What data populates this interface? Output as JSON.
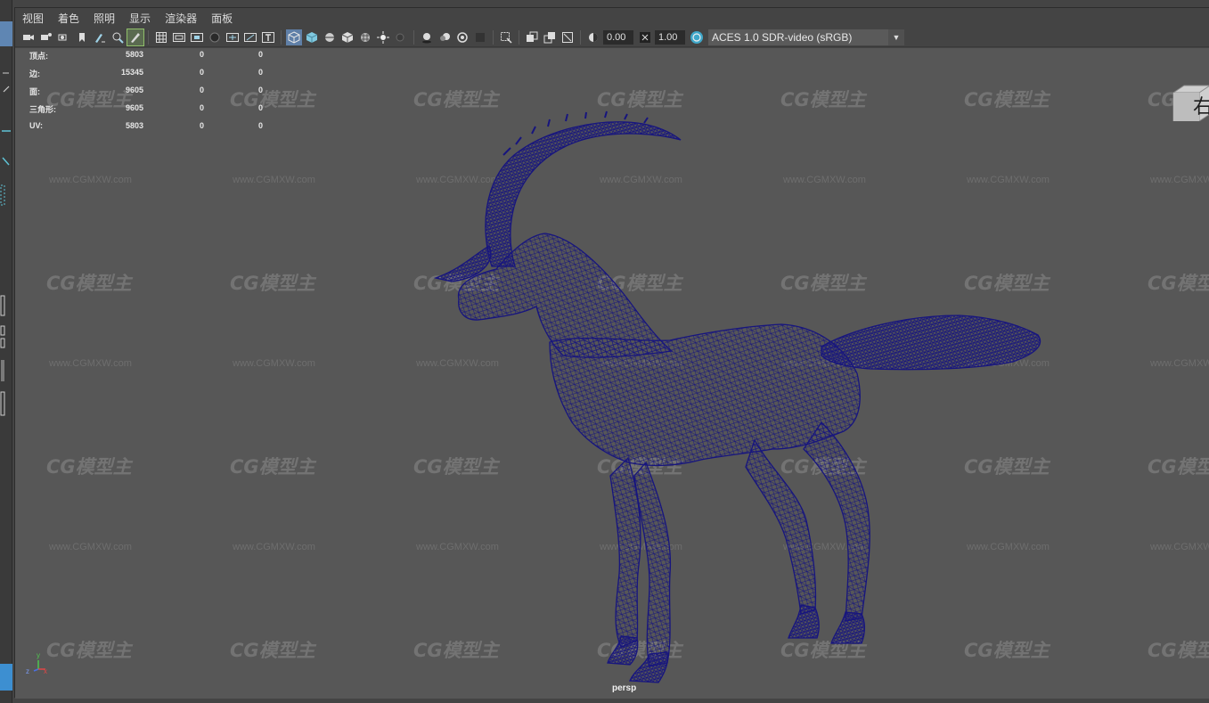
{
  "menu": {
    "items": [
      "视图",
      "着色",
      "照明",
      "显示",
      "渲染器",
      "面板"
    ]
  },
  "toolbar": {
    "exposure_value": "0.00",
    "gamma_value": "1.00",
    "color_space": "ACES 1.0 SDR-video (sRGB)",
    "icons": [
      "camera-icon",
      "camera-attributes-icon",
      "bookmark-icon",
      "image-plane-icon",
      "grease-pencil-icon",
      "2d-pan-zoom-icon",
      "grid-icon",
      "film-gate-icon",
      "resolution-gate-icon",
      "gate-mask-icon",
      "field-chart-icon",
      "safe-action-icon",
      "safe-title-icon",
      "wireframe-icon",
      "smooth-shade-icon",
      "wireframe-on-shaded-icon",
      "default-material-icon",
      "textured-icon",
      "use-all-lights-icon",
      "shadows-icon",
      "screen-space-ao-icon",
      "motion-blur-icon",
      "anti-aliasing-icon",
      "depth-of-field-icon",
      "isolate-select-icon",
      "xray-icon",
      "xray-joints-icon",
      "backface-culling-icon",
      "exposure-icon",
      "gamma-icon",
      "color-management-icon"
    ],
    "accent_active": "#8fbf6a",
    "accent_selected": "#5f7fa7"
  },
  "hud": {
    "rows": [
      {
        "label": "顶点:",
        "c1": "5803",
        "c2": "0",
        "c3": "0"
      },
      {
        "label": "边:",
        "c1": "15345",
        "c2": "0",
        "c3": "0"
      },
      {
        "label": "面:",
        "c1": "9605",
        "c2": "0",
        "c3": "0"
      },
      {
        "label": "三角形:",
        "c1": "9605",
        "c2": "0",
        "c3": "0"
      },
      {
        "label": "UV:",
        "c1": "5803",
        "c2": "0",
        "c3": "0"
      }
    ]
  },
  "viewport": {
    "camera_name": "persp",
    "view_cube_label": "右",
    "background_color": "#575757",
    "wireframe_color": "#17157e",
    "watermark_logo": "CG模型主",
    "watermark_url": "www.CGMXW.com"
  },
  "axis": {
    "x": "x",
    "y": "y",
    "z": "z"
  }
}
